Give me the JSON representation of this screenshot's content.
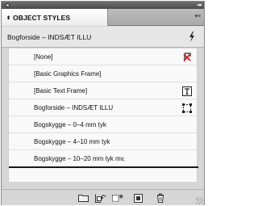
{
  "panel": {
    "tab_label": "OBJECT STYLES",
    "tab_arrows": "⬍",
    "menu_glyph": "▾≡",
    "collapse_glyph": "◂◂",
    "current_style": "Bogforside – INDSÆT ILLU"
  },
  "icons": {
    "close": "close-icon",
    "collapse": "collapse-panel-icon",
    "panel_menu": "panel-menu-icon",
    "new_style_from_selection": "lightning-icon",
    "clear_overrides": "clear-overrides-icon",
    "text_frame": "text-frame-icon",
    "graphics_frame": "graphics-frame-icon"
  },
  "styles": [
    {
      "label": "[None]",
      "icon": "clear-overrides-icon"
    },
    {
      "label": "[Basic Graphics Frame]",
      "icon": ""
    },
    {
      "label": "[Basic Text Frame]",
      "icon": "text-frame-icon"
    },
    {
      "label": "Bogforside – INDSÆT ILLU",
      "icon": "graphics-frame-icon"
    },
    {
      "label": "Bogskygge – 0–4 mm tyk",
      "icon": ""
    },
    {
      "label": "Bogskygge – 4–10 mm tyk",
      "icon": ""
    },
    {
      "label": "Bogskygge – 10–20 mm tyk mv.",
      "icon": ""
    }
  ],
  "bottom_toolbar": [
    {
      "name": "new-style-group-button",
      "icon": "folder-icon"
    },
    {
      "name": "clear-overrides-button",
      "icon": "clear-overrides-arrow-icon"
    },
    {
      "name": "clear-attributes-button",
      "icon": "frame-asterisk-icon"
    },
    {
      "name": "create-new-style-button",
      "icon": "new-page-icon"
    },
    {
      "name": "delete-style-button",
      "icon": "trash-icon"
    }
  ],
  "colors": {
    "panel_bg": "#d6d6d6",
    "list_bg": "#f9f9f9",
    "titlebar": "#4b4b4b"
  }
}
